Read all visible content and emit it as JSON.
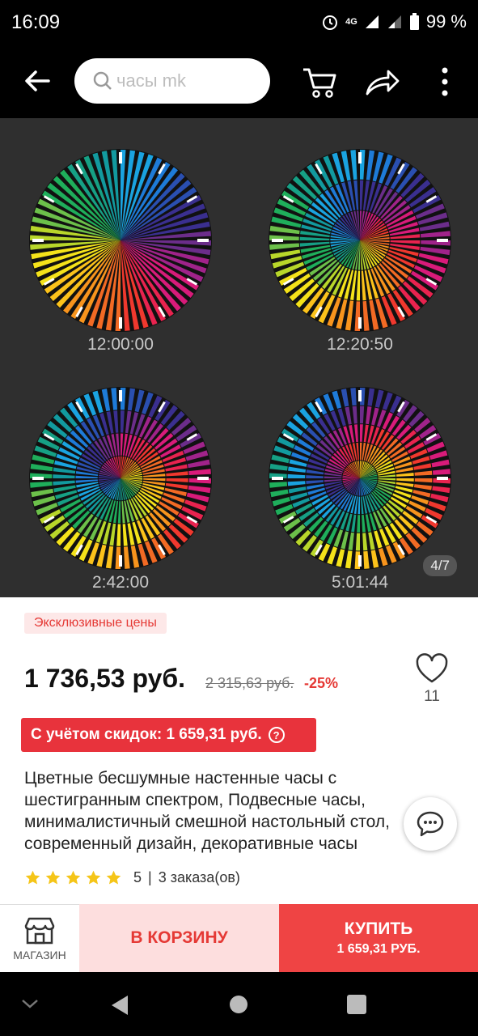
{
  "status": {
    "time": "16:09",
    "network": "4G",
    "battery": "99 %"
  },
  "header": {
    "search_placeholder": "часы mk"
  },
  "gallery": {
    "clocks": [
      {
        "label": "12:00:00",
        "rings": 1
      },
      {
        "label": "12:20:50",
        "rings": 3
      },
      {
        "label": "2:42:00",
        "rings": 4
      },
      {
        "label": "5:01:44",
        "rings": 5
      }
    ],
    "pager": "4/7"
  },
  "product": {
    "badge": "Эксклюзивные цены",
    "price": "1 736,53 руб.",
    "old_price": "2 315,63 руб.",
    "discount": "-25%",
    "favorites": "11",
    "coupon": "С учётом скидок: 1 659,31 руб.",
    "coupon_help": "?",
    "title": "Цветные бесшумные настенные часы с шестигранным спектром, Подвесные часы, минималистичный смешной настольный стол, современный дизайн, декоративные часы",
    "rating": "5",
    "orders": "3 заказа(ов)"
  },
  "actions": {
    "shop_label": "МАГАЗИН",
    "cart_label": "В КОРЗИНУ",
    "buy_label": "КУПИТЬ",
    "buy_price": "1 659,31 РУБ."
  },
  "colors": {
    "accent": "#e53935",
    "buy": "#ef4444",
    "cart_bg": "#fddede"
  }
}
